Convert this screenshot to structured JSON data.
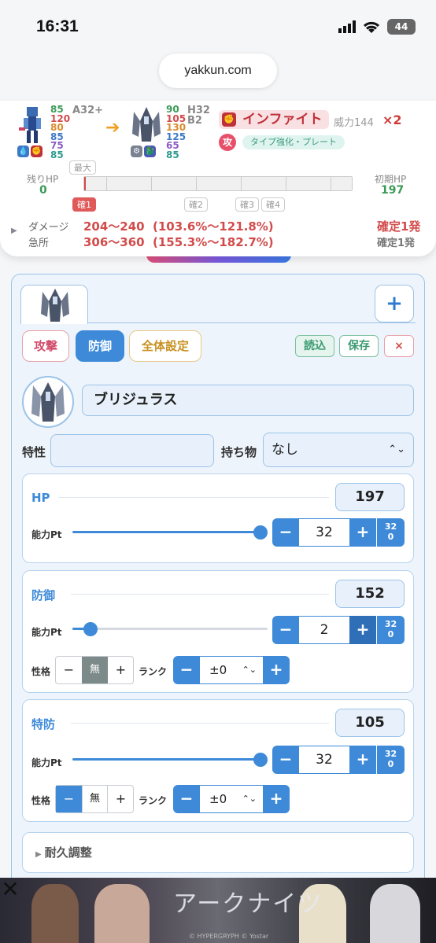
{
  "status_bar": {
    "time": "16:31",
    "battery": "44"
  },
  "browser": {
    "url": "yakkun.com"
  },
  "summary": {
    "attacker": {
      "stats": [
        "85",
        "120",
        "80",
        "85",
        "75",
        "85"
      ],
      "code": "A32+"
    },
    "defender": {
      "stats": [
        "90",
        "105",
        "130",
        "125",
        "65",
        "85"
      ],
      "code_h": "H32",
      "code_b": "B2"
    },
    "move": {
      "name": "インファイト",
      "power": "威力144",
      "multiplier": "×2",
      "attack_tag": "攻",
      "tag": "タイプ強化・プレート"
    },
    "hp": {
      "remaining_label": "残りHP",
      "remaining_value": "0",
      "initial_label": "初期HP",
      "initial_value": "197",
      "max_label": "最大",
      "remaining_fraction": 0.0,
      "markers": [
        "確1",
        "確2",
        "確3",
        "確4"
      ]
    },
    "damage": {
      "label": "ダメージ",
      "range": "204〜240",
      "percent": "(103.6%〜121.8%)",
      "crit_label": "急所",
      "crit_range": "306〜360",
      "crit_percent": "(155.3%〜182.7%)",
      "result": "確定1発",
      "crit_result": "確定1発"
    }
  },
  "editor": {
    "tabs": {
      "add": "+"
    },
    "modes": {
      "attack": "攻撃",
      "defense": "防御",
      "all": "全体設定"
    },
    "actions": {
      "load": "読込",
      "save": "保存",
      "close": "×"
    },
    "pokemon_name": "ブリジュラス",
    "ability_label": "特性",
    "ability_value": "",
    "item_label": "持ち物",
    "item_value": "なし",
    "stats": [
      {
        "name": "HP",
        "value": "197",
        "pt_label": "能力Pt",
        "pt_value": "32",
        "pt_max": "32",
        "pt_min": "0",
        "slider_fraction": 1.0
      },
      {
        "name": "防御",
        "value": "152",
        "pt_label": "能力Pt",
        "pt_value": "2",
        "pt_max": "32",
        "pt_min": "0",
        "slider_fraction": 0.0625,
        "nature_label": "性格",
        "nature": [
          "−",
          "無",
          "+"
        ],
        "rank_label": "ランク",
        "rank_value": "±0"
      },
      {
        "name": "特防",
        "value": "105",
        "pt_label": "能力Pt",
        "pt_value": "32",
        "pt_max": "32",
        "pt_min": "0",
        "slider_fraction": 1.0,
        "nature_label": "性格",
        "nature": [
          "−",
          "無",
          "+"
        ],
        "rank_label": "ランク",
        "rank_value": "±0"
      }
    ],
    "durability_label": "耐久調整"
  },
  "ad": {
    "title": "アークナイツ",
    "copyright": "© HYPERGRYPH  © Yostar"
  },
  "colors": {
    "accent": "#3e8ad8",
    "attack_red": "#d24b4b",
    "hp_green": "#3b9a57"
  }
}
